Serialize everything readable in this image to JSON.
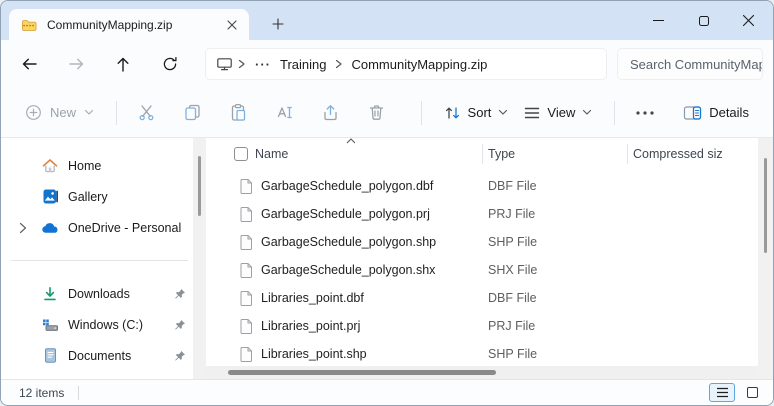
{
  "titlebar": {
    "tab_title": "CommunityMapping.zip"
  },
  "navbar": {
    "breadcrumb": {
      "ellipsis": "···",
      "segment1": "Training",
      "segment2": "CommunityMapping.zip"
    },
    "search_placeholder": "Search CommunityMapp"
  },
  "toolbar": {
    "new_label": "New",
    "sort_label": "Sort",
    "view_label": "View",
    "details_label": "Details"
  },
  "sidebar": {
    "items": [
      {
        "label": "Home"
      },
      {
        "label": "Gallery"
      },
      {
        "label": "OneDrive - Personal"
      },
      {
        "label": "Downloads"
      },
      {
        "label": "Windows (C:)"
      },
      {
        "label": "Documents"
      }
    ]
  },
  "filelist": {
    "columns": [
      "Name",
      "Type",
      "Compressed siz"
    ],
    "rows": [
      {
        "name": "GarbageSchedule_polygon.dbf",
        "type": "DBF File"
      },
      {
        "name": "GarbageSchedule_polygon.prj",
        "type": "PRJ File"
      },
      {
        "name": "GarbageSchedule_polygon.shp",
        "type": "SHP File"
      },
      {
        "name": "GarbageSchedule_polygon.shx",
        "type": "SHX File"
      },
      {
        "name": "Libraries_point.dbf",
        "type": "DBF File"
      },
      {
        "name": "Libraries_point.prj",
        "type": "PRJ File"
      },
      {
        "name": "Libraries_point.shp",
        "type": "SHP File"
      }
    ]
  },
  "statusbar": {
    "items_count": "12 items"
  },
  "colors": {
    "accent": "#1676d2",
    "titlebar_bg": "#d3e2f4",
    "icon_gray": "#9aa1a8",
    "icon_blue": "#7fb1de"
  }
}
